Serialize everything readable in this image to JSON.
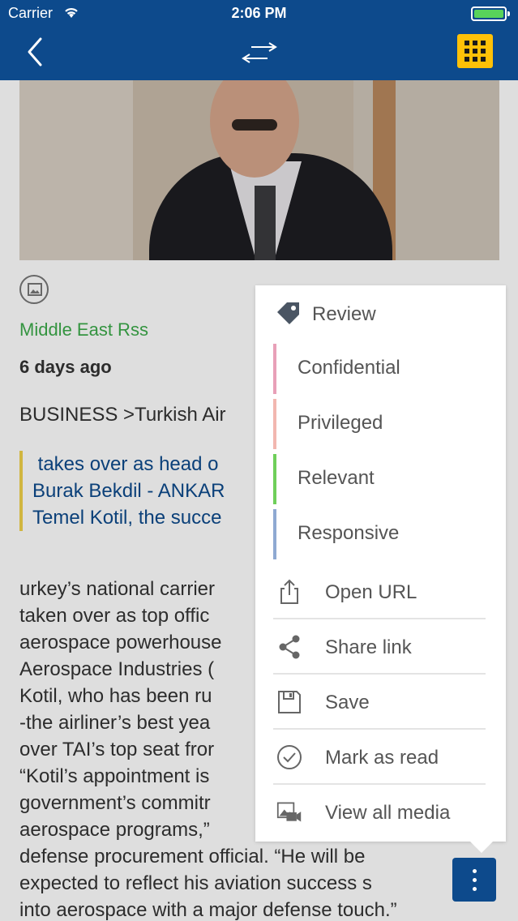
{
  "status_bar": {
    "carrier": "Carrier",
    "time": "2:06 PM"
  },
  "nav": {
    "back_icon": "chevron-left-icon",
    "swap_icon": "swap-arrows-icon",
    "grid_icon": "grid-icon",
    "grid_color": "#ffc107",
    "bar_color": "#0d4a8c"
  },
  "article": {
    "source": "Middle East Rss",
    "age": "6 days ago",
    "category": "BUSINESS >Turkish Air",
    "quote_line1": " takes over as head o",
    "quote_line2": "Burak Bekdil - ANKAR",
    "quote_line3": "Temel Kotil, the succe",
    "body": "urkey’s national carrier\ntaken over as top offic\naerospace powerhouse\nAerospace Industries (\nKotil, who has been ru\n-the airliner’s best yea\nover TAI’s top seat fror\n“Kotil’s appointment is\ngovernment’s commitr\naerospace programs,”\ndefense procurement official. “He will be\nexpected to reflect his aviation success s\ninto aerospace with a major defense touch.”"
  },
  "menu": {
    "header": "Review",
    "review_items": [
      {
        "label": "Confidential",
        "color": "#e8a0b8"
      },
      {
        "label": "Privileged",
        "color": "#f2b7b0"
      },
      {
        "label": "Relevant",
        "color": "#6fcf5a"
      },
      {
        "label": "Responsive",
        "color": "#8fa9d2"
      }
    ],
    "actions": [
      {
        "label": "Open URL",
        "icon": "share-out-icon"
      },
      {
        "label": "Share link",
        "icon": "share-icon"
      },
      {
        "label": "Save",
        "icon": "save-icon"
      },
      {
        "label": "Mark as read",
        "icon": "check-circle-icon"
      },
      {
        "label": "View all media",
        "icon": "media-icon"
      }
    ]
  },
  "fab_icon": "more-vertical-icon"
}
